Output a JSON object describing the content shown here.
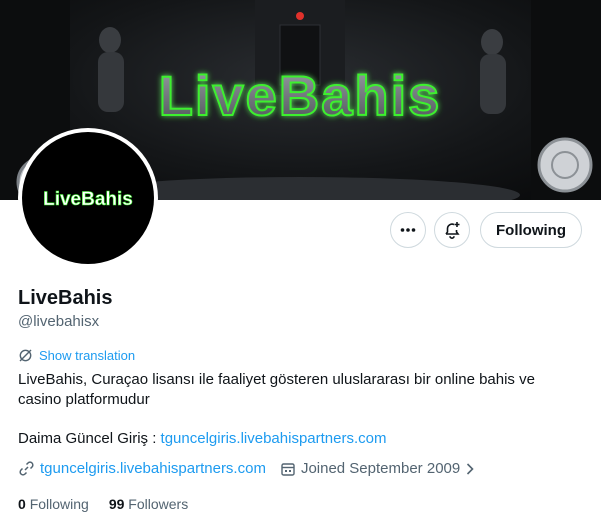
{
  "profile": {
    "banner_brand": "LiveBahis",
    "avatar_brand": "LiveBahis",
    "name": "LiveBahis",
    "handle": "@livebahisx",
    "show_translation": "Show translation",
    "bio": "LiveBahis, Curaçao lisansı ile faaliyet gösteren uluslararası bir online bahis ve casino platformudur",
    "bio_line2_prefix": "Daima Güncel Giriş : ",
    "bio_line2_link": "tguncelgiris.livebahispartners.com",
    "website": "tguncelgiris.livebahispartners.com",
    "joined": "Joined September 2009"
  },
  "actions": {
    "more_icon": "more-horizontal-icon",
    "notify_icon": "bell-plus-icon",
    "following_label": "Following"
  },
  "stats": {
    "following_count": "0",
    "following_label": "Following",
    "followers_count": "99",
    "followers_label": "Followers"
  },
  "colors": {
    "accent": "#1d9bf0",
    "brand_green": "#4cff3a",
    "text": "#0f1419",
    "muted": "#536471"
  }
}
